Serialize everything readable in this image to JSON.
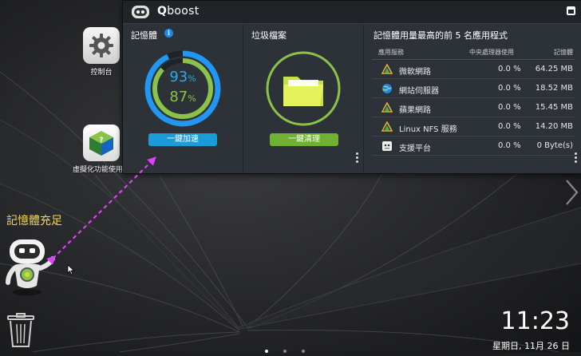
{
  "window": {
    "title_q": "Q",
    "title_rest": "boost"
  },
  "desktop": {
    "icons": [
      {
        "label": "控制台"
      },
      {
        "label": "虛擬化功能使用著"
      }
    ],
    "memory_status": "記憶體充足",
    "clock": "11:23",
    "date": "星期日, 11月 26 日"
  },
  "memory": {
    "title": "記憶體",
    "info_icon": "i",
    "pct_blue": "93",
    "pct_green": "87",
    "pct_unit": "%",
    "ring_blue_fraction": 0.93,
    "ring_green_fraction": 0.87,
    "button": "一鍵加速"
  },
  "junk": {
    "title": "垃圾檔案",
    "button": "一鍵清理"
  },
  "apps": {
    "title": "記憶體用量最高的前 5 名應用程式",
    "headers": {
      "name": "應用服務",
      "cpu": "中央處理器使用",
      "mem": "記憶體"
    },
    "rows": [
      {
        "icon": "qnap-triangle-icon",
        "name": "微軟網路",
        "cpu": "0.0 %",
        "mem": "64.25 MB"
      },
      {
        "icon": "globe-icon",
        "name": "網站伺服器",
        "cpu": "0.0 %",
        "mem": "18.52 MB"
      },
      {
        "icon": "qnap-triangle-icon",
        "name": "蘋果網路",
        "cpu": "0.0 %",
        "mem": "15.45 MB"
      },
      {
        "icon": "qnap-triangle-icon",
        "name": "Linux NFS 服務",
        "cpu": "0.0 %",
        "mem": "14.20 MB"
      },
      {
        "icon": "robot-support-icon",
        "name": "支援平台",
        "cpu": "0.0 %",
        "mem": "0 Byte(s)"
      }
    ]
  },
  "colors": {
    "accent_blue": "#1c9bd6",
    "accent_green": "#70b033",
    "memory_status": "#f4d54a",
    "connector": "#e040fb"
  }
}
